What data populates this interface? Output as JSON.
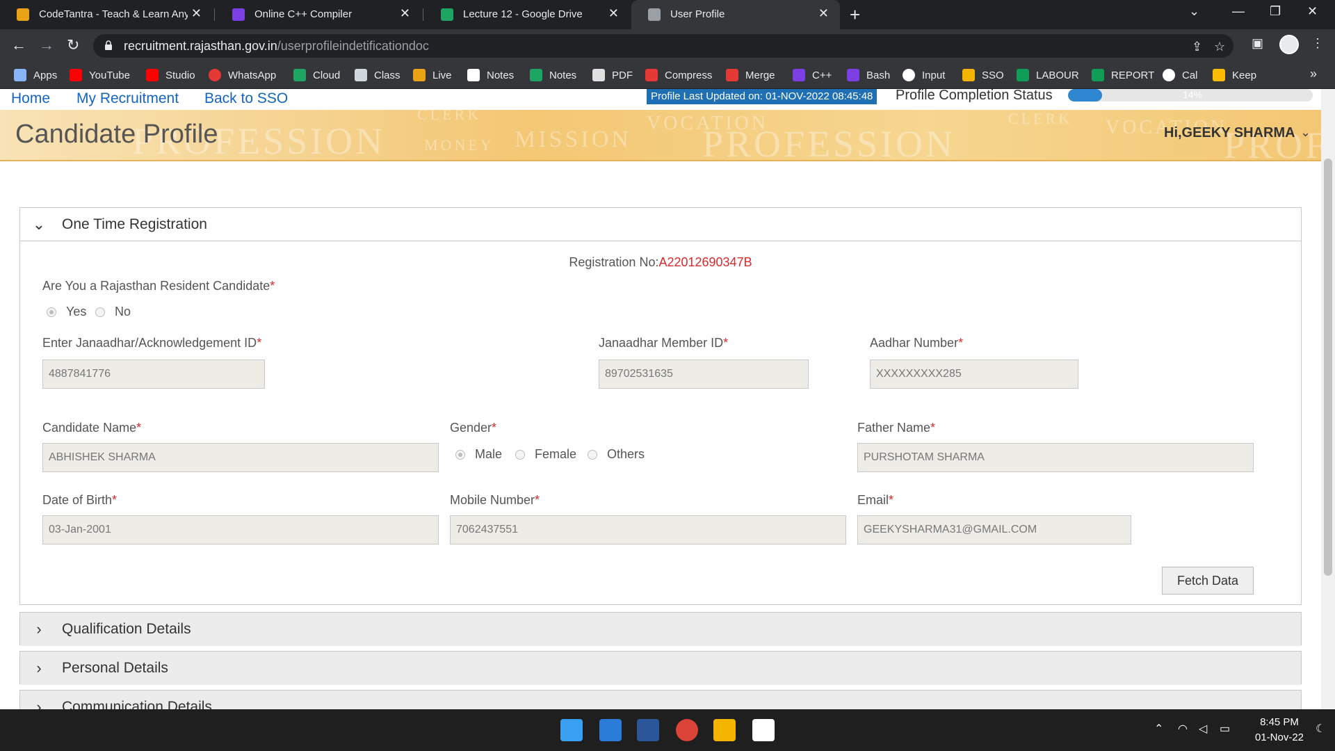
{
  "browser": {
    "tabs": [
      {
        "title": "CodeTantra - Teach & Learn Anyw",
        "color": "#e8a317"
      },
      {
        "title": "Online C++ Compiler",
        "color": "#7b3fe4"
      },
      {
        "title": "Lecture 12 - Google Drive",
        "color": "#1fa463"
      },
      {
        "title": "User Profile",
        "color": "#9aa0a6"
      }
    ],
    "url_host": "recruitment.rajasthan.gov.in",
    "url_path": "/userprofileindetificationdoc",
    "bookmarks": [
      {
        "label": "Apps",
        "color": "#8ab4f8"
      },
      {
        "label": "YouTube",
        "color": "#ff0000"
      },
      {
        "label": "Studio",
        "color": "#ff0000"
      },
      {
        "label": "WhatsApp",
        "color": "#e53935"
      },
      {
        "label": "Cloud",
        "color": "#1fa463"
      },
      {
        "label": "Class",
        "color": "#cfd8dc"
      },
      {
        "label": "Live",
        "color": "#e8a317"
      },
      {
        "label": "Notes",
        "color": "#ffffff"
      },
      {
        "label": "Notes",
        "color": "#1fa463"
      },
      {
        "label": "PDF",
        "color": "#e0e0e0"
      },
      {
        "label": "Compress",
        "color": "#e53935"
      },
      {
        "label": "Merge",
        "color": "#e53935"
      },
      {
        "label": "C++",
        "color": "#7b3fe4"
      },
      {
        "label": "Bash",
        "color": "#7b3fe4"
      },
      {
        "label": "Input",
        "color": "#ffffff"
      },
      {
        "label": "SSO",
        "color": "#f4b400"
      },
      {
        "label": "LABOUR",
        "color": "#0f9d58"
      },
      {
        "label": "REPORT",
        "color": "#0f9d58"
      },
      {
        "label": "Cal",
        "color": "#ffffff"
      },
      {
        "label": "Keep",
        "color": "#fbbc04"
      }
    ]
  },
  "page": {
    "nav": {
      "home": "Home",
      "my_recruitment": "My Recruitment",
      "back_sso": "Back to SSO"
    },
    "updated": "Profile Last Updated on: 01-NOV-2022 08:45:48",
    "completion_label": "Profile Completion Status",
    "completion_percent": 14,
    "completion_text": "14%",
    "banner_title": "Candidate Profile",
    "greeting": "Hi,GEEKY SHARMA",
    "banner_watermarks": [
      "PROFESSION",
      "CLERK",
      "MISSION",
      "MONEY",
      "VOCATION",
      "PROFESSION",
      "CLERK",
      "VOCATION",
      "PROFE"
    ]
  },
  "otr": {
    "title": "One Time Registration",
    "reg_label": "Registration No:",
    "reg_value": "A22012690347B",
    "resident_q": "Are You a Rajasthan Resident Candidate",
    "resident_yes": "Yes",
    "resident_no": "No",
    "janaadhar_label": "Enter Janaadhar/Acknowledgement ID",
    "janaadhar_value": "4887841776",
    "member_label": "Janaadhar Member ID",
    "member_value": "89702531635",
    "aadhar_label": "Aadhar Number",
    "aadhar_value": "XXXXXXXXX285",
    "name_label": "Candidate Name",
    "name_value": "ABHISHEK SHARMA",
    "gender_label": "Gender",
    "gender_male": "Male",
    "gender_female": "Female",
    "gender_others": "Others",
    "father_label": "Father Name",
    "father_value": "PURSHOTAM SHARMA",
    "dob_label": "Date of Birth",
    "dob_value": "03-Jan-2001",
    "mobile_label": "Mobile Number",
    "mobile_value": "7062437551",
    "email_label": "Email",
    "email_value": "GEEKYSHARMA31@GMAIL.COM",
    "fetch": "Fetch Data",
    "required": "*"
  },
  "sections": {
    "qualification": "Qualification Details",
    "personal": "Personal Details",
    "communication": "Communication Details"
  },
  "taskbar": {
    "time": "8:45 PM",
    "date": "01-Nov-22"
  }
}
